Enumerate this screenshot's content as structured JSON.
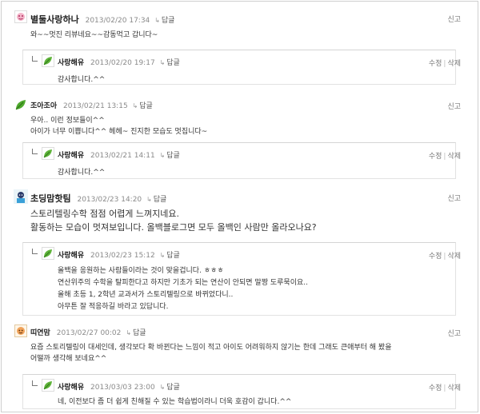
{
  "ui": {
    "reply_label": "답글",
    "report_label": "신고",
    "edit_label": "수정",
    "delete_label": "삭제",
    "action_sep": "|"
  },
  "comments": [
    {
      "nick": "별둘사랑하나",
      "date": "2013/02/20 17:34",
      "lines": [
        "와~~멋진 리뷰네요~~감동먹고 갑니다~"
      ],
      "reply": {
        "nick": "사랑해유",
        "date": "2013/02/20 19:17",
        "lines": [
          "감사합니다.^^"
        ]
      }
    },
    {
      "nick": "조아조아",
      "date": "2013/02/21 13:15",
      "lines": [
        "우아.. 이런 정보들이^^",
        "아이가 너무 이쁩니다^^ 헤헤~ 진지한 모습도 멋집니다~"
      ],
      "reply": {
        "nick": "사랑해유",
        "date": "2013/02/21 14:11",
        "lines": [
          "감사합니다.^^"
        ]
      }
    },
    {
      "nick": "초딩맘핫팀",
      "date": "2013/02/23 14:20",
      "lines": [
        "스토리텔링수학 점점 어렵게 느껴지네요.",
        "활동하는 모습이 멋져보입니다. 올백블로그면 모두 올백인 사람만 올라오나요?"
      ],
      "reply": {
        "nick": "사랑해유",
        "date": "2013/02/23 15:12",
        "lines": [
          "올백을 응원하는 사람들이라는 것이 맞을겁니다. ㅎㅎㅎ",
          "연산위주의 수학을 탈피한다고 하지만 기초가 되는 연산이 안되면 말짱 도루묵이요..",
          "올해 초등 1, 2학년 교과서가 스토리텔링으로 바뀌었다니..",
          "아무튼 잘 적응하길 바라고 있답니다."
        ]
      }
    },
    {
      "nick": "띠연맘",
      "date": "2013/02/27 00:02",
      "lines": [
        "요즘 스토리텔링이 대세인데, 생각보다 확 바뀐다는 느낌이 적고 아이도 어려워하지 않기는 한데 그래도 큰애부터 해 봤을",
        "어떨까 생각해 보네요^^"
      ],
      "reply": {
        "nick": "사랑해유",
        "date": "2013/03/03 23:00",
        "lines": [
          "네, 이전보다 좀 더 쉽게 친해질 수 있는 학습법이라니 더욱 호감이 갑니다.^^"
        ]
      }
    }
  ]
}
